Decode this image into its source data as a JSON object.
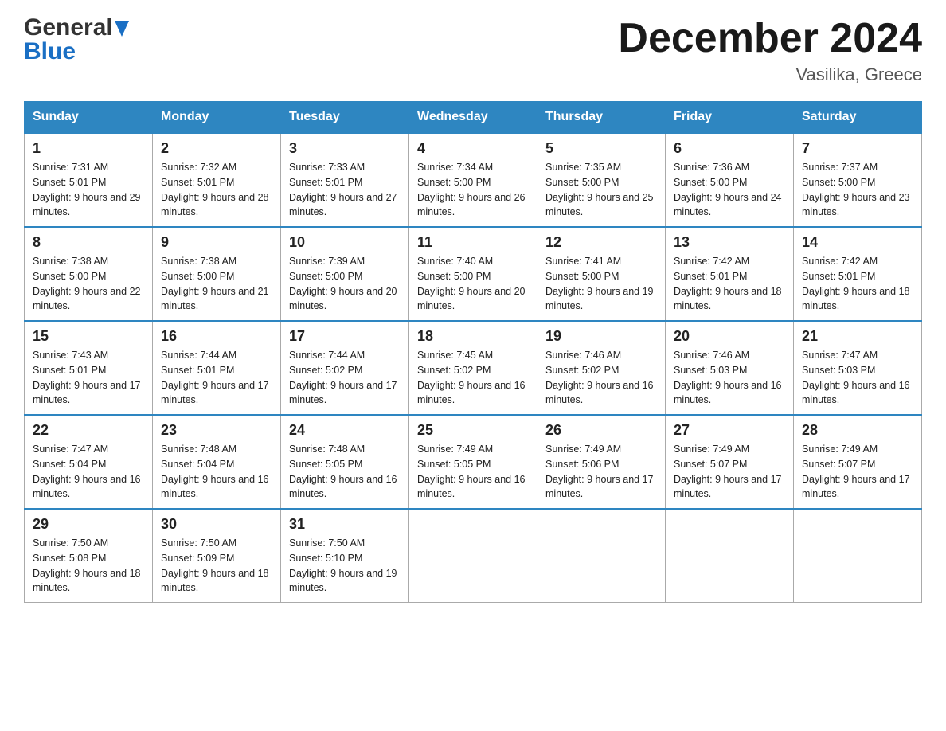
{
  "header": {
    "logo_line1": "General",
    "logo_line2": "Blue",
    "month_title": "December 2024",
    "location": "Vasilika, Greece"
  },
  "days_of_week": [
    "Sunday",
    "Monday",
    "Tuesday",
    "Wednesday",
    "Thursday",
    "Friday",
    "Saturday"
  ],
  "weeks": [
    [
      {
        "day": "1",
        "sunrise": "Sunrise: 7:31 AM",
        "sunset": "Sunset: 5:01 PM",
        "daylight": "Daylight: 9 hours and 29 minutes."
      },
      {
        "day": "2",
        "sunrise": "Sunrise: 7:32 AM",
        "sunset": "Sunset: 5:01 PM",
        "daylight": "Daylight: 9 hours and 28 minutes."
      },
      {
        "day": "3",
        "sunrise": "Sunrise: 7:33 AM",
        "sunset": "Sunset: 5:01 PM",
        "daylight": "Daylight: 9 hours and 27 minutes."
      },
      {
        "day": "4",
        "sunrise": "Sunrise: 7:34 AM",
        "sunset": "Sunset: 5:00 PM",
        "daylight": "Daylight: 9 hours and 26 minutes."
      },
      {
        "day": "5",
        "sunrise": "Sunrise: 7:35 AM",
        "sunset": "Sunset: 5:00 PM",
        "daylight": "Daylight: 9 hours and 25 minutes."
      },
      {
        "day": "6",
        "sunrise": "Sunrise: 7:36 AM",
        "sunset": "Sunset: 5:00 PM",
        "daylight": "Daylight: 9 hours and 24 minutes."
      },
      {
        "day": "7",
        "sunrise": "Sunrise: 7:37 AM",
        "sunset": "Sunset: 5:00 PM",
        "daylight": "Daylight: 9 hours and 23 minutes."
      }
    ],
    [
      {
        "day": "8",
        "sunrise": "Sunrise: 7:38 AM",
        "sunset": "Sunset: 5:00 PM",
        "daylight": "Daylight: 9 hours and 22 minutes."
      },
      {
        "day": "9",
        "sunrise": "Sunrise: 7:38 AM",
        "sunset": "Sunset: 5:00 PM",
        "daylight": "Daylight: 9 hours and 21 minutes."
      },
      {
        "day": "10",
        "sunrise": "Sunrise: 7:39 AM",
        "sunset": "Sunset: 5:00 PM",
        "daylight": "Daylight: 9 hours and 20 minutes."
      },
      {
        "day": "11",
        "sunrise": "Sunrise: 7:40 AM",
        "sunset": "Sunset: 5:00 PM",
        "daylight": "Daylight: 9 hours and 20 minutes."
      },
      {
        "day": "12",
        "sunrise": "Sunrise: 7:41 AM",
        "sunset": "Sunset: 5:00 PM",
        "daylight": "Daylight: 9 hours and 19 minutes."
      },
      {
        "day": "13",
        "sunrise": "Sunrise: 7:42 AM",
        "sunset": "Sunset: 5:01 PM",
        "daylight": "Daylight: 9 hours and 18 minutes."
      },
      {
        "day": "14",
        "sunrise": "Sunrise: 7:42 AM",
        "sunset": "Sunset: 5:01 PM",
        "daylight": "Daylight: 9 hours and 18 minutes."
      }
    ],
    [
      {
        "day": "15",
        "sunrise": "Sunrise: 7:43 AM",
        "sunset": "Sunset: 5:01 PM",
        "daylight": "Daylight: 9 hours and 17 minutes."
      },
      {
        "day": "16",
        "sunrise": "Sunrise: 7:44 AM",
        "sunset": "Sunset: 5:01 PM",
        "daylight": "Daylight: 9 hours and 17 minutes."
      },
      {
        "day": "17",
        "sunrise": "Sunrise: 7:44 AM",
        "sunset": "Sunset: 5:02 PM",
        "daylight": "Daylight: 9 hours and 17 minutes."
      },
      {
        "day": "18",
        "sunrise": "Sunrise: 7:45 AM",
        "sunset": "Sunset: 5:02 PM",
        "daylight": "Daylight: 9 hours and 16 minutes."
      },
      {
        "day": "19",
        "sunrise": "Sunrise: 7:46 AM",
        "sunset": "Sunset: 5:02 PM",
        "daylight": "Daylight: 9 hours and 16 minutes."
      },
      {
        "day": "20",
        "sunrise": "Sunrise: 7:46 AM",
        "sunset": "Sunset: 5:03 PM",
        "daylight": "Daylight: 9 hours and 16 minutes."
      },
      {
        "day": "21",
        "sunrise": "Sunrise: 7:47 AM",
        "sunset": "Sunset: 5:03 PM",
        "daylight": "Daylight: 9 hours and 16 minutes."
      }
    ],
    [
      {
        "day": "22",
        "sunrise": "Sunrise: 7:47 AM",
        "sunset": "Sunset: 5:04 PM",
        "daylight": "Daylight: 9 hours and 16 minutes."
      },
      {
        "day": "23",
        "sunrise": "Sunrise: 7:48 AM",
        "sunset": "Sunset: 5:04 PM",
        "daylight": "Daylight: 9 hours and 16 minutes."
      },
      {
        "day": "24",
        "sunrise": "Sunrise: 7:48 AM",
        "sunset": "Sunset: 5:05 PM",
        "daylight": "Daylight: 9 hours and 16 minutes."
      },
      {
        "day": "25",
        "sunrise": "Sunrise: 7:49 AM",
        "sunset": "Sunset: 5:05 PM",
        "daylight": "Daylight: 9 hours and 16 minutes."
      },
      {
        "day": "26",
        "sunrise": "Sunrise: 7:49 AM",
        "sunset": "Sunset: 5:06 PM",
        "daylight": "Daylight: 9 hours and 17 minutes."
      },
      {
        "day": "27",
        "sunrise": "Sunrise: 7:49 AM",
        "sunset": "Sunset: 5:07 PM",
        "daylight": "Daylight: 9 hours and 17 minutes."
      },
      {
        "day": "28",
        "sunrise": "Sunrise: 7:49 AM",
        "sunset": "Sunset: 5:07 PM",
        "daylight": "Daylight: 9 hours and 17 minutes."
      }
    ],
    [
      {
        "day": "29",
        "sunrise": "Sunrise: 7:50 AM",
        "sunset": "Sunset: 5:08 PM",
        "daylight": "Daylight: 9 hours and 18 minutes."
      },
      {
        "day": "30",
        "sunrise": "Sunrise: 7:50 AM",
        "sunset": "Sunset: 5:09 PM",
        "daylight": "Daylight: 9 hours and 18 minutes."
      },
      {
        "day": "31",
        "sunrise": "Sunrise: 7:50 AM",
        "sunset": "Sunset: 5:10 PM",
        "daylight": "Daylight: 9 hours and 19 minutes."
      },
      null,
      null,
      null,
      null
    ]
  ]
}
